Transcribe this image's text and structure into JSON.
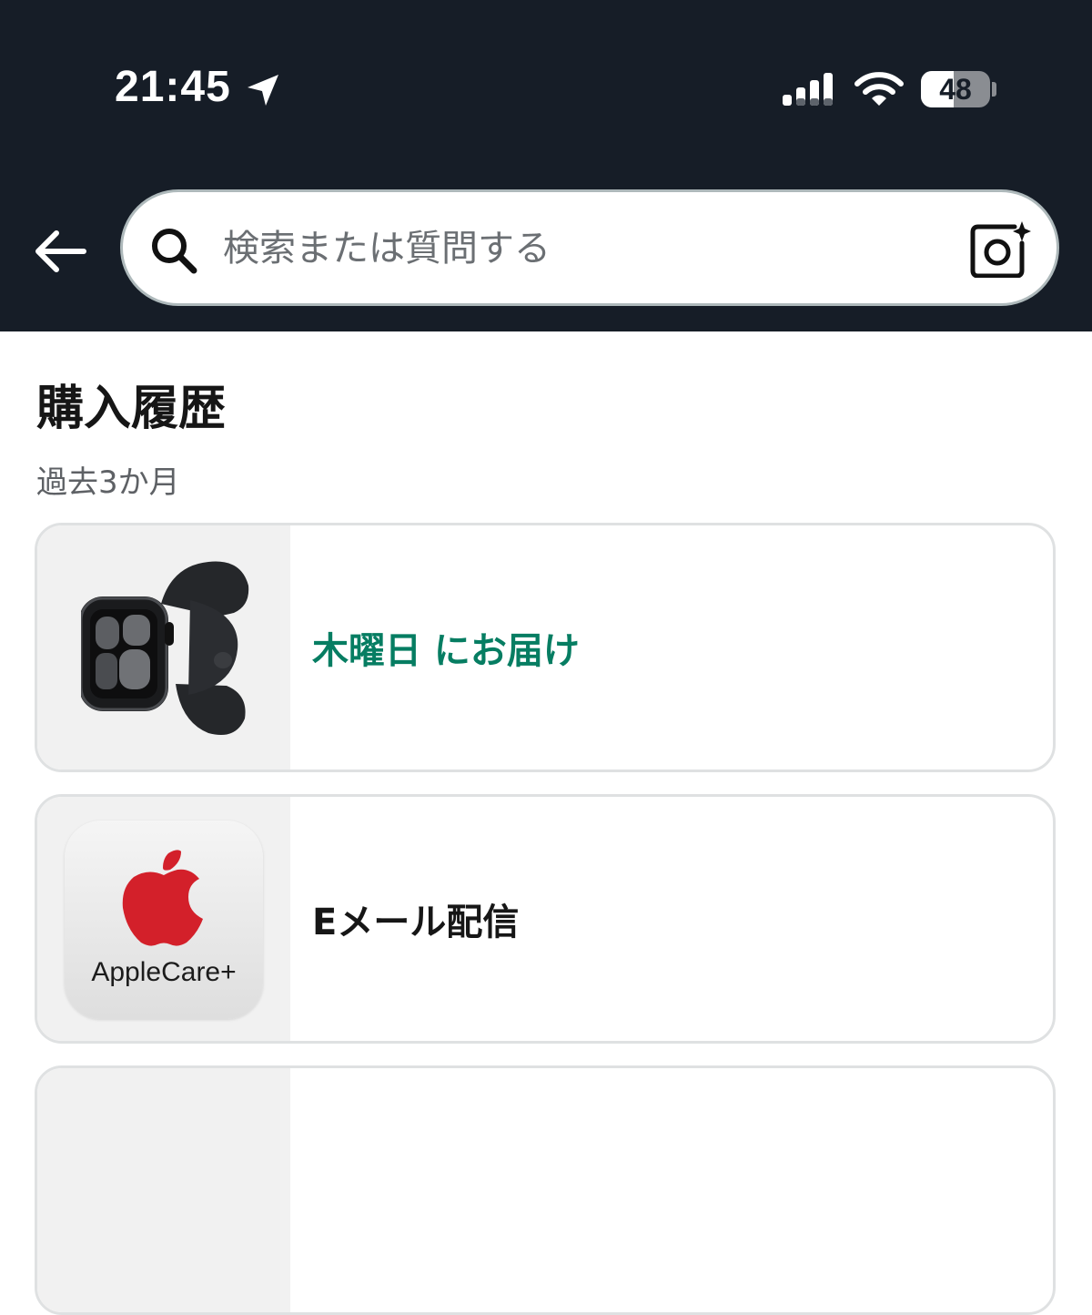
{
  "status_bar": {
    "time": "21:45",
    "battery_percent": "48",
    "battery_level": 0.48
  },
  "search": {
    "placeholder": "検索または質問する",
    "value": ""
  },
  "colors": {
    "header_bg": "#161d27",
    "delivery_text": "#067d62",
    "apple_red": "#d3202a"
  },
  "section": {
    "title": "購入履歴",
    "subtitle": "過去3か月"
  },
  "orders": [
    {
      "status": "木曜日 にお届け",
      "image_icon": "apple-watch-image"
    },
    {
      "status": "Eメール配信",
      "image_icon": "applecare-logo",
      "logo_text": "AppleCare+"
    }
  ]
}
